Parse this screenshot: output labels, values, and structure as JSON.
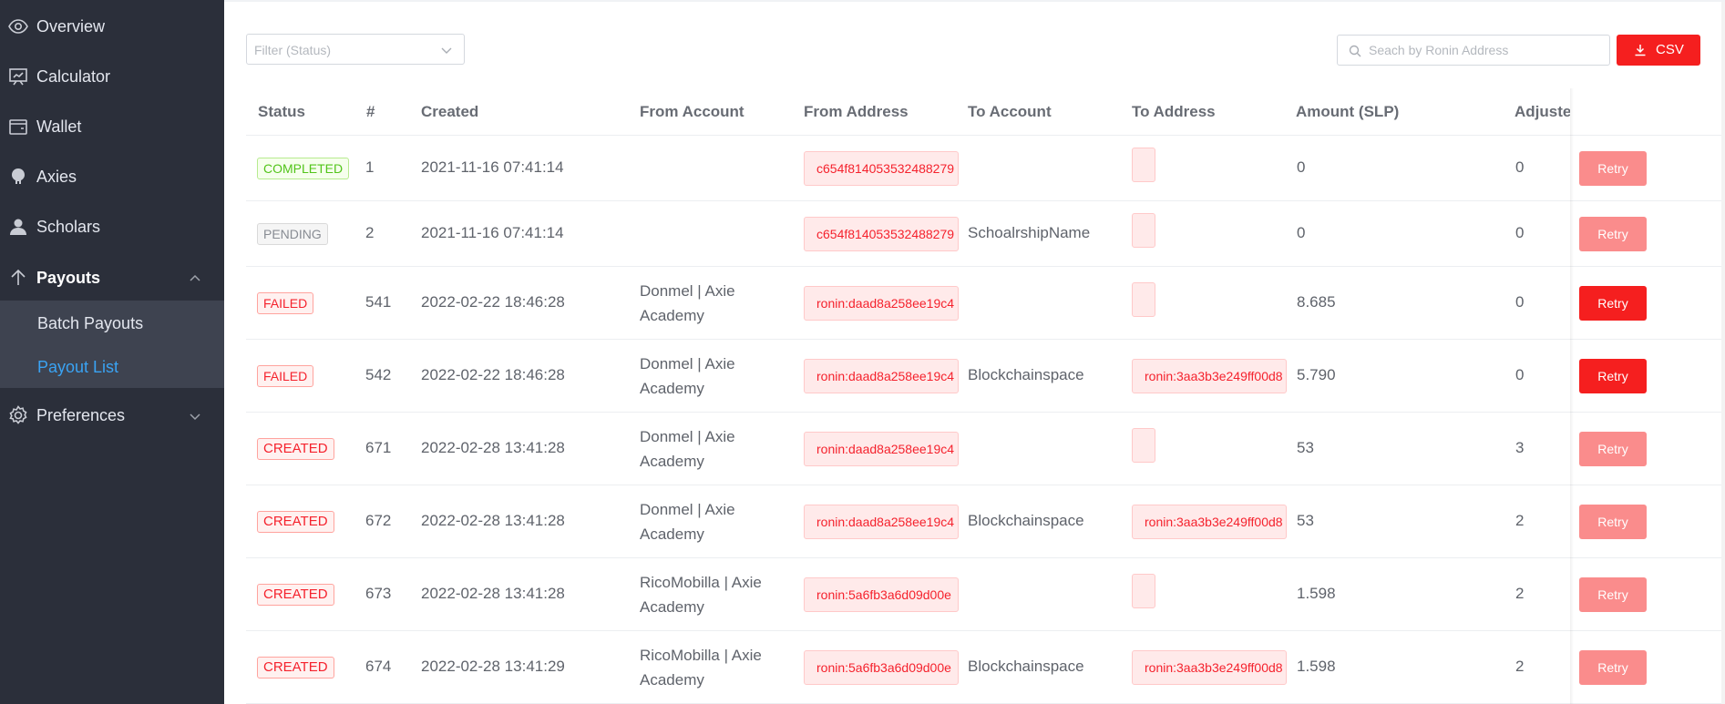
{
  "sidebar": {
    "items": [
      {
        "label": "Overview",
        "icon": "eye-icon"
      },
      {
        "label": "Calculator",
        "icon": "calculator-icon"
      },
      {
        "label": "Wallet",
        "icon": "wallet-icon"
      },
      {
        "label": "Axies",
        "icon": "axie-icon"
      },
      {
        "label": "Scholars",
        "icon": "user-icon"
      },
      {
        "label": "Payouts",
        "icon": "arrow-up-icon"
      },
      {
        "label": "Preferences",
        "icon": "gear-icon"
      }
    ],
    "payouts_submenu": [
      {
        "label": "Batch Payouts"
      },
      {
        "label": "Payout List"
      }
    ],
    "accent_color": "#3aa3f3",
    "background_color": "#2b2f3a"
  },
  "toolbar": {
    "filter_placeholder": "Filter (Status)",
    "search_placeholder": "Seach by Ronin Address",
    "csv_label": "CSV",
    "csv_color": "#f51f1f"
  },
  "table": {
    "headers": [
      "Status",
      "#",
      "Created",
      "From Account",
      "From Address",
      "To Account",
      "To Address",
      "Amount (SLP)",
      "Adjuste"
    ],
    "rows": [
      {
        "status": "COMPLETED",
        "id": "1",
        "created": "2021-11-16 07:41:14",
        "from_account": "",
        "from_address": "c654f814053532488279",
        "to_account": "",
        "to_address": "",
        "amount": "0",
        "adjusted": "0",
        "retry": "Retry"
      },
      {
        "status": "PENDING",
        "id": "2",
        "created": "2021-11-16 07:41:14",
        "from_account": "",
        "from_address": "c654f814053532488279",
        "to_account": "SchoalrshipName",
        "to_address": "",
        "amount": "0",
        "adjusted": "0",
        "retry": "Retry"
      },
      {
        "status": "FAILED",
        "id": "541",
        "created": "2022-02-22 18:46:28",
        "from_account": "Donmel | Axie Academy",
        "from_address": "ronin:daad8a258ee19c4",
        "to_account": "",
        "to_address": "",
        "amount": "8.685",
        "adjusted": "0",
        "retry": "Retry"
      },
      {
        "status": "FAILED",
        "id": "542",
        "created": "2022-02-22 18:46:28",
        "from_account": "Donmel | Axie Academy",
        "from_address": "ronin:daad8a258ee19c4",
        "to_account": "Blockchainspace",
        "to_address": "ronin:3aa3b3e249ff00d8",
        "amount": "5.790",
        "adjusted": "0",
        "retry": "Retry"
      },
      {
        "status": "CREATED",
        "id": "671",
        "created": "2022-02-28 13:41:28",
        "from_account": "Donmel | Axie Academy",
        "from_address": "ronin:daad8a258ee19c4",
        "to_account": "",
        "to_address": "",
        "amount": "53",
        "adjusted": "3",
        "retry": "Retry"
      },
      {
        "status": "CREATED",
        "id": "672",
        "created": "2022-02-28 13:41:28",
        "from_account": "Donmel | Axie Academy",
        "from_address": "ronin:daad8a258ee19c4",
        "to_account": "Blockchainspace",
        "to_address": "ronin:3aa3b3e249ff00d8",
        "amount": "53",
        "adjusted": "2",
        "retry": "Retry"
      },
      {
        "status": "CREATED",
        "id": "673",
        "created": "2022-02-28 13:41:28",
        "from_account": "RicoMobilla | Axie Academy",
        "from_address": "ronin:5a6fb3a6d09d00e",
        "to_account": "",
        "to_address": "",
        "amount": "1.598",
        "adjusted": "2",
        "retry": "Retry"
      },
      {
        "status": "CREATED",
        "id": "674",
        "created": "2022-02-28 13:41:29",
        "from_account": "RicoMobilla | Axie Academy",
        "from_address": "ronin:5a6fb3a6d09d00e",
        "to_account": "Blockchainspace",
        "to_address": "ronin:3aa3b3e249ff00d8",
        "amount": "1.598",
        "adjusted": "2",
        "retry": "Retry"
      }
    ]
  }
}
